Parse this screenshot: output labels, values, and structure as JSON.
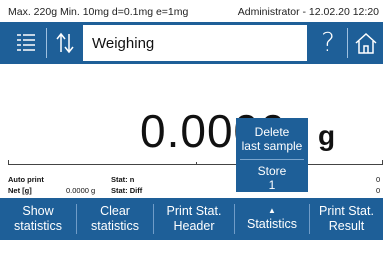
{
  "status_bar": {
    "capacity_info": "Max. 220g  Min. 10mg  d=0.1mg  e=1mg",
    "user_datetime": "Administrator - 12.02.20 12:20"
  },
  "header": {
    "title": "Weighing",
    "icons": [
      "menu-list-icon",
      "transfer-arrows-icon",
      "help-icon",
      "home-icon"
    ],
    "help_glyph": "?"
  },
  "display": {
    "weight_value": "0.0000",
    "unit": "g"
  },
  "popup_menu": {
    "item1_line1": "Delete",
    "item1_line2": "last sample",
    "item2_line1": "Store",
    "item2_line2": "1"
  },
  "stats": {
    "auto_print": "Auto print",
    "net_label": "Net [g]",
    "net_value": "0.0000 g",
    "stat_n": "Stat: n",
    "stat_diff": "Stat: Diff",
    "right_n": "0",
    "right_diff": "0"
  },
  "buttons": [
    {
      "line1": "Show",
      "line2": "statistics"
    },
    {
      "line1": "Clear",
      "line2": "statistics"
    },
    {
      "line1": "Print Stat.",
      "line2": "Header"
    },
    {
      "line1": "Statistics",
      "line2": ""
    },
    {
      "line1": "Print Stat.",
      "line2": "Result"
    }
  ],
  "colors": {
    "primary_blue": "#1e5f98",
    "background": "#ffffff"
  }
}
